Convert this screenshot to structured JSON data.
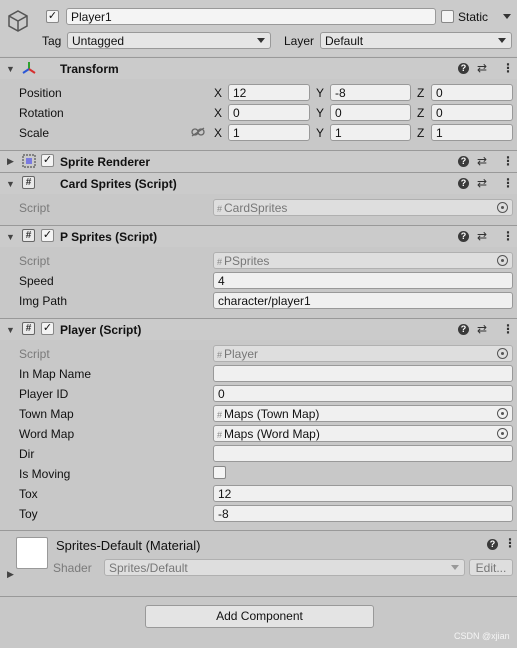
{
  "gameobject": {
    "name": "Player1",
    "active": true,
    "static_label": "Static",
    "tag_label": "Tag",
    "tag_value": "Untagged",
    "layer_label": "Layer",
    "layer_value": "Default"
  },
  "transform": {
    "title": "Transform",
    "position_label": "Position",
    "rotation_label": "Rotation",
    "scale_label": "Scale",
    "axis_x": "X",
    "axis_y": "Y",
    "axis_z": "Z",
    "position": {
      "x": "12",
      "y": "-8",
      "z": "0"
    },
    "rotation": {
      "x": "0",
      "y": "0",
      "z": "0"
    },
    "scale": {
      "x": "1",
      "y": "1",
      "z": "1"
    }
  },
  "sprite_renderer": {
    "title": "Sprite Renderer"
  },
  "card_sprites": {
    "title": "Card Sprites (Script)",
    "script_label": "Script",
    "script_value": "CardSprites"
  },
  "p_sprites": {
    "title": "P Sprites (Script)",
    "script_label": "Script",
    "script_value": "PSprites",
    "speed_label": "Speed",
    "speed_value": "4",
    "img_path_label": "Img Path",
    "img_path_value": "character/player1"
  },
  "player": {
    "title": "Player (Script)",
    "script_label": "Script",
    "script_value": "Player",
    "in_map_name_label": "In Map Name",
    "in_map_name_value": "",
    "player_id_label": "Player ID",
    "player_id_value": "0",
    "town_map_label": "Town Map",
    "town_map_value": "Maps (Town Map)",
    "word_map_label": "Word Map",
    "word_map_value": "Maps (Word Map)",
    "dir_label": "Dir",
    "dir_value": "",
    "is_moving_label": "Is Moving",
    "is_moving": false,
    "tox_label": "Tox",
    "tox_value": "12",
    "toy_label": "Toy",
    "toy_value": "-8"
  },
  "material": {
    "title": "Sprites-Default (Material)",
    "shader_label": "Shader",
    "shader_value": "Sprites/Default",
    "edit_label": "Edit..."
  },
  "add_component_label": "Add Component",
  "watermark": "CSDN @xjian"
}
